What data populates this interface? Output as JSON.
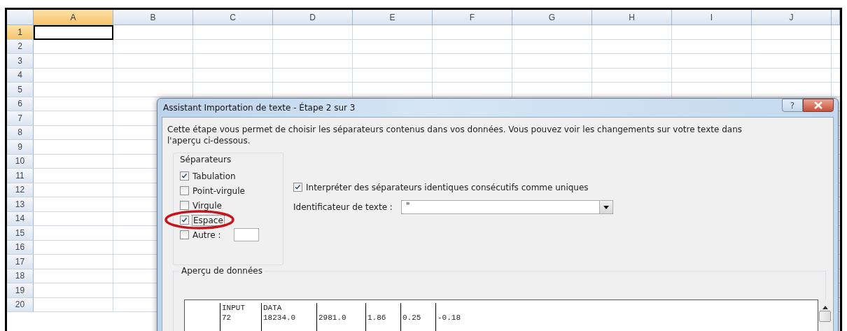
{
  "spreadsheet": {
    "columns": [
      {
        "label": "A",
        "selected": true
      },
      {
        "label": "B",
        "selected": false
      },
      {
        "label": "C",
        "selected": false
      },
      {
        "label": "D",
        "selected": false
      },
      {
        "label": "E",
        "selected": false
      },
      {
        "label": "F",
        "selected": false
      },
      {
        "label": "G",
        "selected": false
      },
      {
        "label": "H",
        "selected": false
      },
      {
        "label": "I",
        "selected": false
      },
      {
        "label": "J",
        "selected": false
      }
    ],
    "rows": [
      {
        "label": "1",
        "selected": true
      },
      {
        "label": "2",
        "selected": false
      },
      {
        "label": "3",
        "selected": false
      },
      {
        "label": "4",
        "selected": false
      },
      {
        "label": "5",
        "selected": false
      },
      {
        "label": "6",
        "selected": false
      },
      {
        "label": "7",
        "selected": false
      },
      {
        "label": "8",
        "selected": false
      },
      {
        "label": "9",
        "selected": false
      },
      {
        "label": "10",
        "selected": false
      },
      {
        "label": "11",
        "selected": false
      },
      {
        "label": "12",
        "selected": false
      },
      {
        "label": "13",
        "selected": false
      },
      {
        "label": "14",
        "selected": false
      },
      {
        "label": "15",
        "selected": false
      },
      {
        "label": "16",
        "selected": false
      },
      {
        "label": "17",
        "selected": false
      },
      {
        "label": "18",
        "selected": false
      },
      {
        "label": "19",
        "selected": false
      },
      {
        "label": "20",
        "selected": false
      }
    ]
  },
  "dialog": {
    "title": "Assistant Importation de texte - Étape 2 sur 3",
    "help_button": "?",
    "description": "Cette étape vous permet de choisir les séparateurs contenus dans vos données. Vous pouvez voir les changements sur votre texte dans l'aperçu ci-dessous.",
    "separators": {
      "title": "Séparateurs",
      "options": [
        {
          "label": "Tabulation",
          "checked": true
        },
        {
          "label": "Point-virgule",
          "checked": false
        },
        {
          "label": "Virgule",
          "checked": false
        },
        {
          "label": "Espace",
          "checked": true,
          "highlighted": true
        },
        {
          "label": "Autre :",
          "checked": false,
          "has_field": true
        }
      ]
    },
    "consecutive": {
      "label": "Interpréter des séparateurs identiques consécutifs comme uniques",
      "checked": true
    },
    "text_qualifier": {
      "label": "Identificateur de texte :",
      "value": "\""
    },
    "preview": {
      "title": "Aperçu de données",
      "rows": [
        [
          "INPUT",
          "DATA",
          null,
          null,
          null,
          null
        ],
        [
          "72",
          "18234.0",
          "2981.0",
          "1.86",
          "0.25",
          "-0.18"
        ]
      ]
    }
  }
}
